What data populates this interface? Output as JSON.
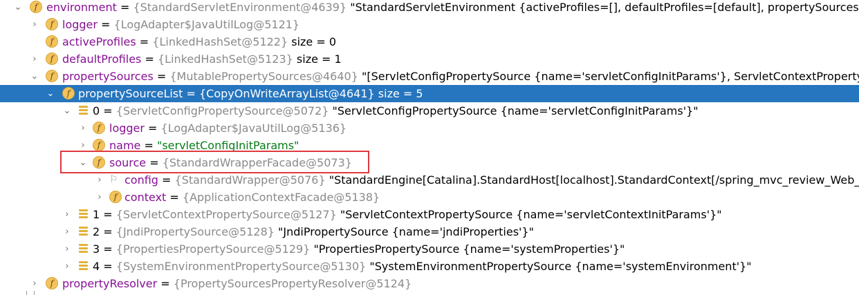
{
  "rows": [
    {
      "arrow": "⌄",
      "icon": "f",
      "name": "environment",
      "type": "{StandardServletEnvironment@4639}",
      "extra": " \"StandardServletEnvironment {activeProfiles=[], defaultProfiles=[default], propertySources=[ServletCo"
    },
    {
      "arrow": "›",
      "icon": "f",
      "name": "logger",
      "type": "{LogAdapter$JavaUtilLog@5121}",
      "extra": ""
    },
    {
      "arrow": "",
      "icon": "f",
      "name": "activeProfiles",
      "type": "{LinkedHashSet@5122}",
      "extra": "  size = 0"
    },
    {
      "arrow": "›",
      "icon": "f",
      "name": "defaultProfiles",
      "type": "{LinkedHashSet@5123}",
      "extra": "  size = 1"
    },
    {
      "arrow": "⌄",
      "icon": "f",
      "name": "propertySources",
      "type": "{MutablePropertySources@4640}",
      "extra": " \"[ServletConfigPropertySource {name='servletConfigInitParams'}, ServletContextPropertySource {na"
    },
    {
      "arrow": "⌄",
      "icon": "f",
      "name": "propertySourceList",
      "type": "{CopyOnWriteArrayList@4641}",
      "extra": "  size = 5"
    },
    {
      "arrow": "⌄",
      "icon": "arr",
      "name": "0",
      "type": "{ServletConfigPropertySource@5072}",
      "extra": " \"ServletConfigPropertySource {name='servletConfigInitParams'}\""
    },
    {
      "arrow": "›",
      "icon": "f",
      "name": "logger",
      "type": "{LogAdapter$JavaUtilLog@5136}",
      "extra": ""
    },
    {
      "arrow": "›",
      "icon": "f",
      "name": "name",
      "type": "",
      "extra": "",
      "str": "\"servletConfigInitParams\""
    },
    {
      "arrow": "⌄",
      "icon": "f",
      "name": "source",
      "type": "{StandardWrapperFacade@5073}",
      "extra": ""
    },
    {
      "arrow": "›",
      "icon": "flag",
      "name": "config",
      "type": "{StandardWrapper@5076}",
      "extra": " \"StandardEngine[Catalina].StandardHost[localhost].StandardContext[/spring_mvc_review_Web_exploded"
    },
    {
      "arrow": "›",
      "icon": "f",
      "name": "context",
      "type": "{ApplicationContextFacade@5138}",
      "extra": ""
    },
    {
      "arrow": "›",
      "icon": "arr",
      "name": "1",
      "type": "{ServletContextPropertySource@5127}",
      "extra": " \"ServletContextPropertySource {name='servletContextInitParams'}\""
    },
    {
      "arrow": "›",
      "icon": "arr",
      "name": "2",
      "type": "{JndiPropertySource@5128}",
      "extra": " \"JndiPropertySource {name='jndiProperties'}\""
    },
    {
      "arrow": "›",
      "icon": "arr",
      "name": "3",
      "type": "{PropertiesPropertySource@5129}",
      "extra": " \"PropertiesPropertySource {name='systemProperties'}\""
    },
    {
      "arrow": "›",
      "icon": "arr",
      "name": "4",
      "type": "{SystemEnvironmentPropertySource@5130}",
      "extra": " \"SystemEnvironmentPropertySource {name='systemEnvironment'}\""
    },
    {
      "arrow": "›",
      "icon": "f",
      "name": "propertyResolver",
      "type": "{PropertySourcesPropertyResolver@5124}",
      "extra": ""
    }
  ],
  "eq": " = ",
  "selected_index": 5,
  "highlight_index": 9
}
